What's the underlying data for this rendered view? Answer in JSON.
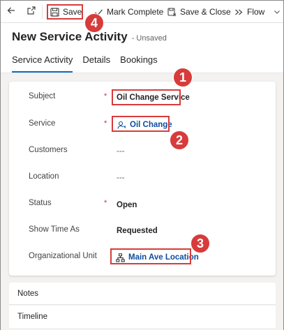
{
  "toolbar": {
    "save_label": "Save",
    "mark_complete_label": "Mark Complete",
    "save_close_label": "Save & Close",
    "flow_label": "Flow"
  },
  "header": {
    "title": "New Service Activity",
    "status": "- Unsaved"
  },
  "tabs": [
    {
      "label": "Service Activity",
      "active": true
    },
    {
      "label": "Details",
      "active": false
    },
    {
      "label": "Bookings",
      "active": false
    }
  ],
  "form": {
    "subject": {
      "label": "Subject",
      "value": "Oil Change Service",
      "required": "*"
    },
    "service": {
      "label": "Service",
      "value": "Oil Change",
      "required": "*"
    },
    "customers": {
      "label": "Customers",
      "value": "---"
    },
    "location": {
      "label": "Location",
      "value": "---"
    },
    "status": {
      "label": "Status",
      "value": "Open",
      "required": "*"
    },
    "show_time_as": {
      "label": "Show Time As",
      "value": "Requested"
    },
    "organizational_unit": {
      "label": "Organizational Unit",
      "value": "Main Ave Location"
    }
  },
  "sections": {
    "notes": "Notes",
    "timeline": "Timeline"
  },
  "callouts": [
    "1",
    "2",
    "3",
    "4"
  ],
  "colors": {
    "accent": "#0f6cbd",
    "link": "#0f4c9e",
    "callout": "#d83b3b",
    "required": "#c4314b"
  },
  "icons": [
    "back-arrow-icon",
    "pop-out-icon",
    "save-icon",
    "checkmark-icon",
    "save-close-icon",
    "flow-icon",
    "chevron-down-icon",
    "service-icon",
    "org-unit-icon"
  ]
}
